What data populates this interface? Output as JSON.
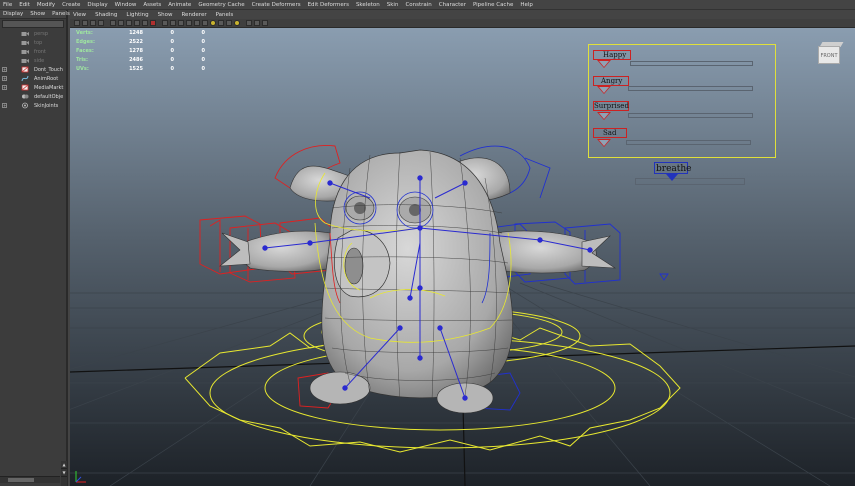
{
  "menubar": {
    "items": [
      "File",
      "Edit",
      "Modify",
      "Create",
      "Display",
      "Window",
      "Assets",
      "Animate",
      "Geometry Cache",
      "Create Deformers",
      "Edit Deformers",
      "Skeleton",
      "Skin",
      "Constrain",
      "Character",
      "Pipeline Cache",
      "Help"
    ]
  },
  "outliner": {
    "menu": [
      "Display",
      "Show",
      "Panels"
    ],
    "nodes": [
      {
        "label": "persp",
        "icon": "camera-icon",
        "dim": true,
        "expandable": false
      },
      {
        "label": "top",
        "icon": "camera-icon",
        "dim": true,
        "expandable": false
      },
      {
        "label": "front",
        "icon": "camera-icon",
        "dim": true,
        "expandable": false
      },
      {
        "label": "side",
        "icon": "camera-icon",
        "dim": true,
        "expandable": false
      },
      {
        "label": "Dont_Touch",
        "icon": "group-icon",
        "dim": false,
        "expandable": true
      },
      {
        "label": "AnimRoot",
        "icon": "curve-icon",
        "dim": false,
        "expandable": true
      },
      {
        "label": "MediaMarkt",
        "icon": "group-icon",
        "dim": false,
        "expandable": true
      },
      {
        "label": "defaultObje",
        "icon": "set-icon",
        "dim": false,
        "expandable": false
      },
      {
        "label": "SkinJoints",
        "icon": "joint-icon",
        "dim": false,
        "expandable": true
      }
    ]
  },
  "viewport": {
    "menu": [
      "View",
      "Shading",
      "Lighting",
      "Show",
      "Renderer",
      "Panels"
    ],
    "hud": [
      {
        "label": "Verts:",
        "v1": "1248",
        "v2": "0",
        "v3": "0"
      },
      {
        "label": "Edges:",
        "v1": "2522",
        "v2": "0",
        "v3": "0"
      },
      {
        "label": "Faces:",
        "v1": "1278",
        "v2": "0",
        "v3": "0"
      },
      {
        "label": "Tris:",
        "v1": "2486",
        "v2": "0",
        "v3": "0"
      },
      {
        "label": "UVs:",
        "v1": "1525",
        "v2": "0",
        "v3": "0"
      }
    ],
    "viewcube_label": "FRONT",
    "face_controls": {
      "happy": "Happy",
      "angry": "Angry",
      "surprised": "Surprised",
      "sad": "Sad"
    },
    "breathe_label": "breathe",
    "colors": {
      "background_top": "#8a9db0",
      "background_bottom": "#1d2228",
      "mesh": "#c8c8c8",
      "control_left": "#e02020",
      "control_right": "#2030d0",
      "control_center": "#e8e830",
      "joint": "#2a2ad0"
    }
  }
}
